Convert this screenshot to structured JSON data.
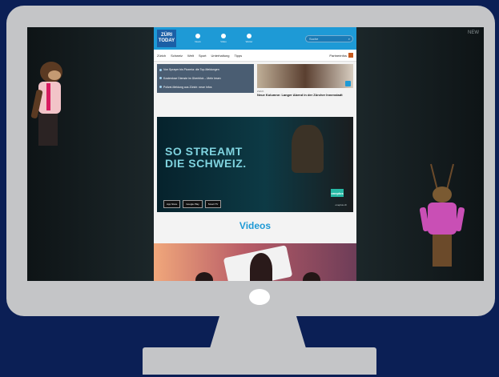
{
  "screen_corner_text": "NEW",
  "site": {
    "logo_lines": [
      "ZÜRI",
      "TODAY"
    ],
    "nav": [
      {
        "label": "News",
        "icon": "home-icon"
      },
      {
        "label": "Video",
        "icon": "video-icon"
      },
      {
        "label": "Wetter",
        "icon": "weather-icon"
      }
    ],
    "search_placeholder": "Suche",
    "subnav": [
      "Zürich",
      "Schweiz",
      "Welt",
      "Sport",
      "Unterhaltung",
      "Tipps"
    ],
    "subnav_right": "Partnerinfos",
    "links": [
      "Von Sprayer bis Pizzeria: die Top-Meldungen",
      "Kostenlose Dienste im Überblick – Mehr lesen",
      "Polizei-Meldung aus Zürich: neue Infos"
    ],
    "article": {
      "kicker": "Zürich",
      "title": "Neue Kolumne: Langer Abend in der Zürcher Innenstadt"
    },
    "banner": {
      "line1": "SO STREAMT",
      "line2": "DIE SCHWEIZ.",
      "logo": "oneplus",
      "stores": [
        "App Store",
        "Google Play",
        "Smart TV"
      ],
      "footnote": "oneplus.ch"
    },
    "section_title": "Videos"
  },
  "colors": {
    "background": "#0b1f55",
    "monitor": "#c4c5c7",
    "accent": "#1e9ad6"
  }
}
